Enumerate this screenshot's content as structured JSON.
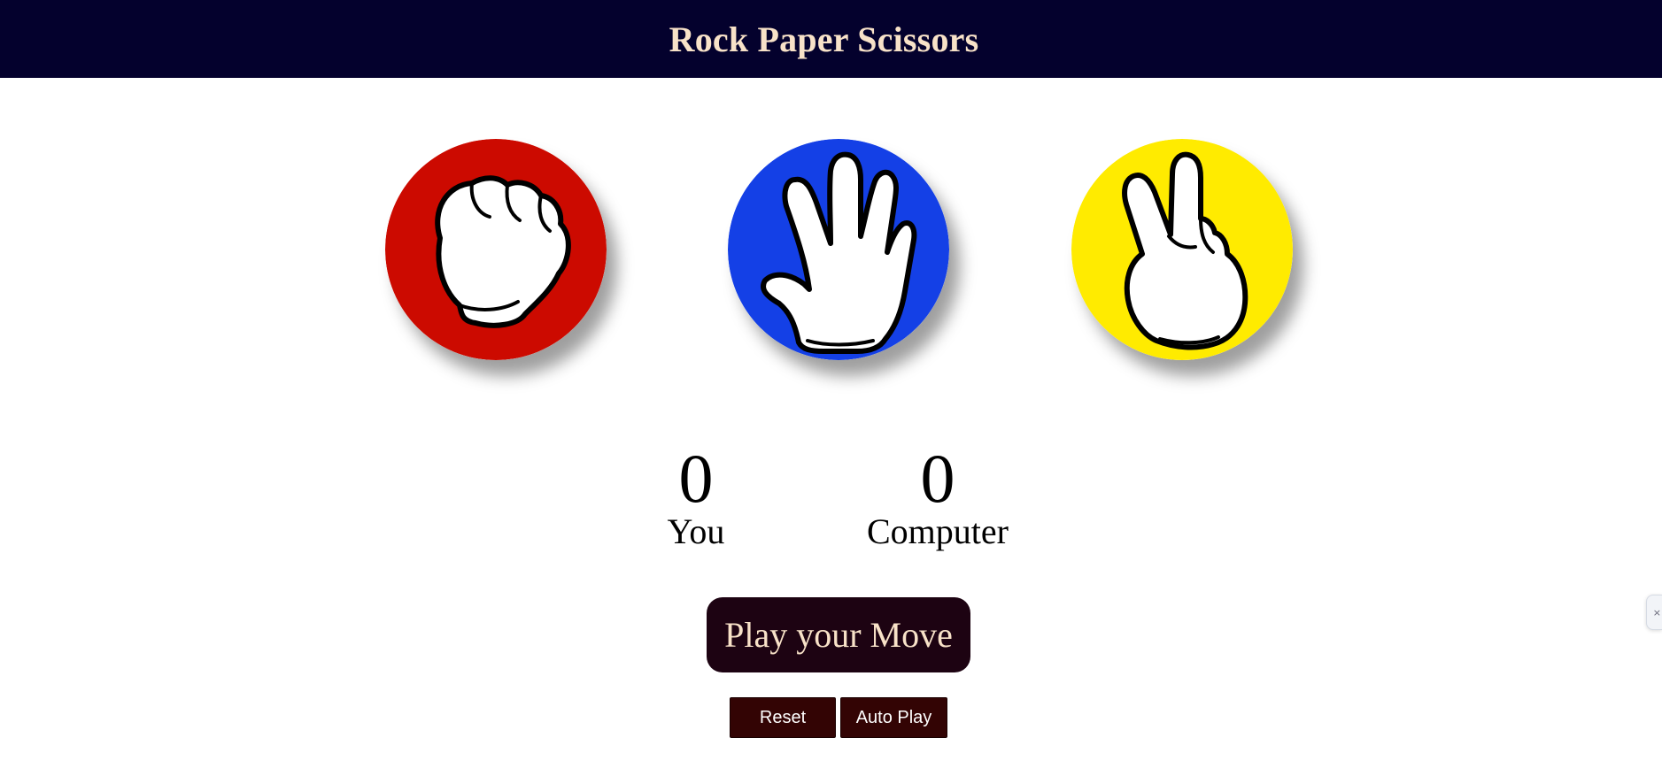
{
  "header": {
    "title": "Rock Paper Scissors"
  },
  "choices": [
    {
      "name": "rock",
      "icon": "rock-fist-icon",
      "color": "#cc0a00"
    },
    {
      "name": "paper",
      "icon": "paper-hand-icon",
      "color": "#1440e6"
    },
    {
      "name": "scissors",
      "icon": "scissors-hand-icon",
      "color": "#ffeb00"
    }
  ],
  "score": {
    "you_value": "0",
    "you_label": "You",
    "computer_value": "0",
    "computer_label": "Computer"
  },
  "buttons": {
    "play_label": "Play your Move",
    "reset_label": "Reset",
    "autoplay_label": "Auto Play"
  },
  "edge_tab": {
    "icon": "close-icon",
    "text": "×"
  },
  "colors": {
    "header_bg": "#04012d",
    "title_text": "#f8e2c8",
    "play_bg": "#1d0312",
    "small_btn_bg": "#330404"
  }
}
